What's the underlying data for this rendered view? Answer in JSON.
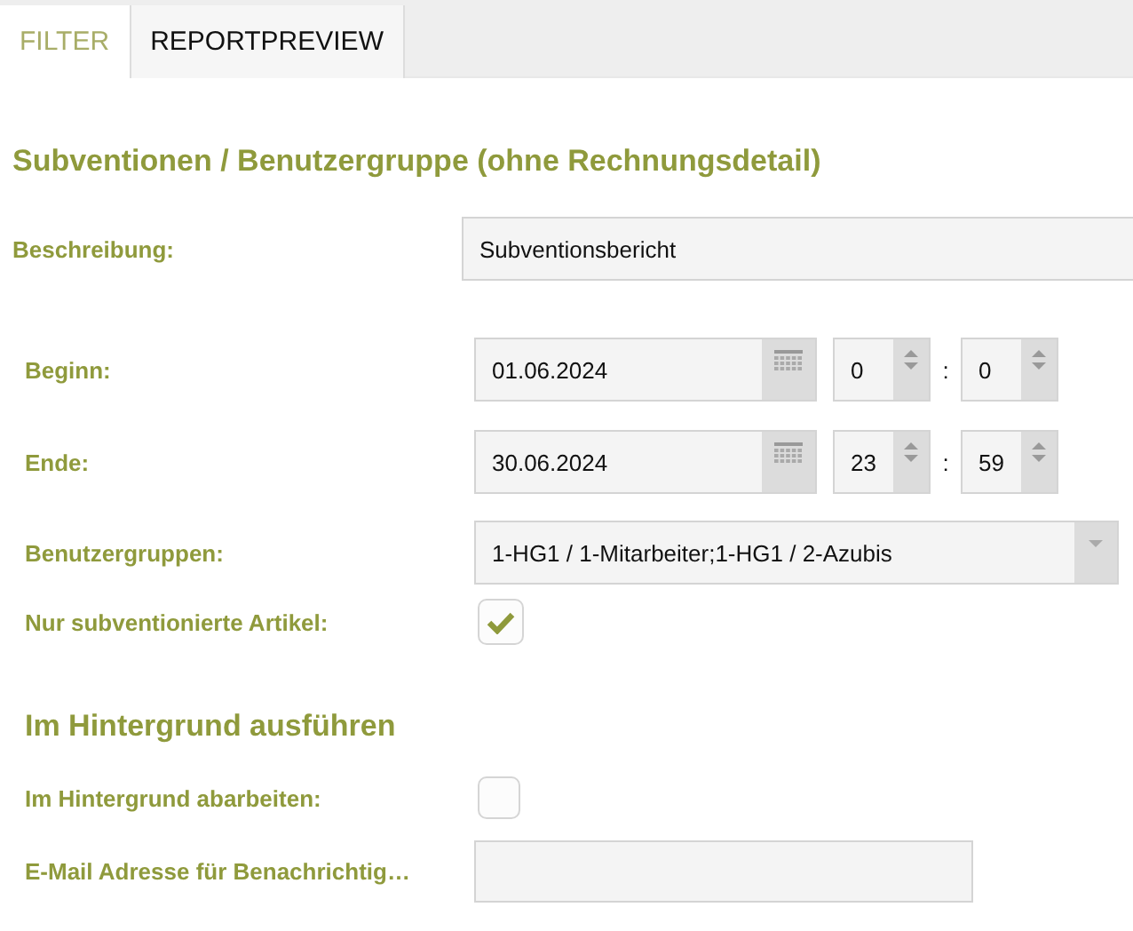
{
  "tabs": [
    {
      "label": "FILTER",
      "selected": true
    },
    {
      "label": "REPORTPREVIEW",
      "selected": false
    }
  ],
  "title": "Subventionen / Benutzergruppe (ohne Rechnungsdetail)",
  "description": {
    "label": "Beschreibung:",
    "value": "Subventionsbericht"
  },
  "fields": [
    {
      "kind": "datetime",
      "label": "Beginn:",
      "date": "01.06.2024",
      "hour": "0",
      "separator": ":",
      "minute": "0"
    },
    {
      "kind": "datetime",
      "label": "Ende:",
      "date": "30.06.2024",
      "hour": "23",
      "separator": ":",
      "minute": "59"
    },
    {
      "kind": "select",
      "label": "Benutzergruppen:",
      "value": "1-HG1 / 1-Mitarbeiter;1-HG1 / 2-Azubis"
    },
    {
      "kind": "checkbox",
      "label": "Nur subventionierte Artikel:",
      "checked": true
    }
  ],
  "background": {
    "title": "Im Hintergrund ausführen",
    "fields": [
      {
        "kind": "checkbox",
        "label": "Im Hintergrund abarbeiten:",
        "checked": false
      },
      {
        "kind": "text",
        "label": "E-Mail Adresse für Benachrichtig…"
      }
    ]
  }
}
